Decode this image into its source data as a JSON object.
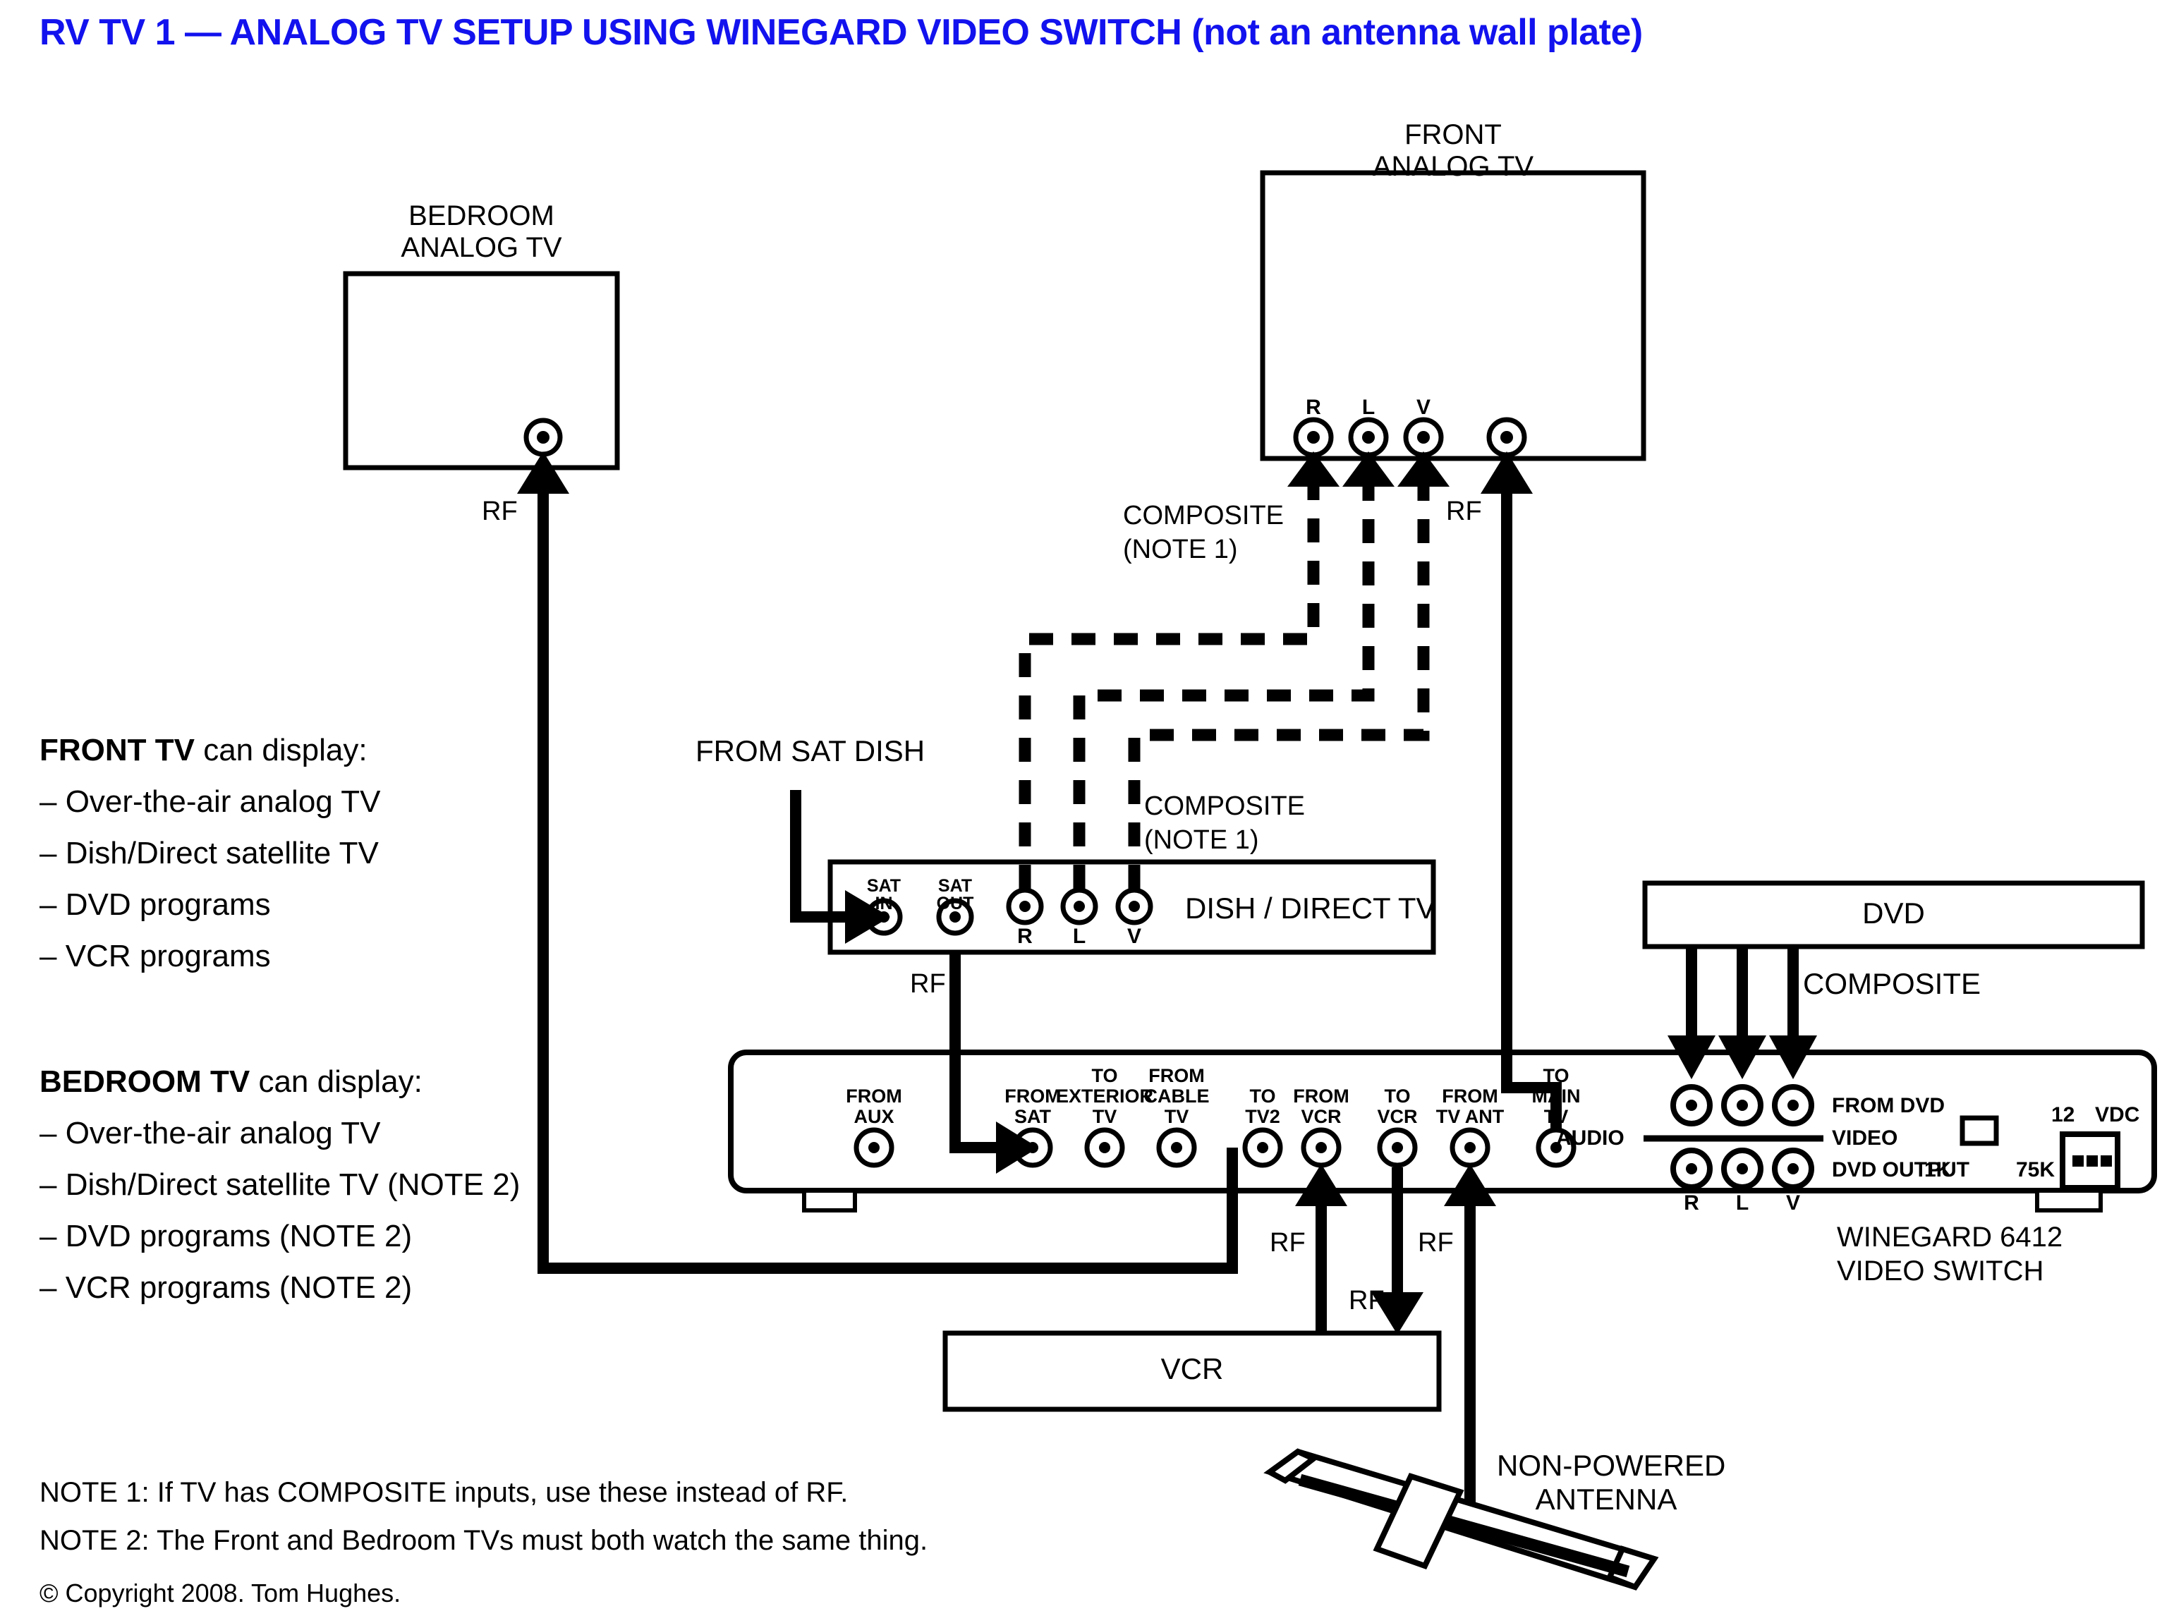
{
  "title": "RV TV 1 — ANALOG TV SETUP USING WINEGARD VIDEO SWITCH (not an antenna wall plate)",
  "colors": {
    "title": "#1212ee",
    "line": "#000000",
    "background": "#ffffff"
  },
  "devices": {
    "bedroom_tv": {
      "label_line1": "BEDROOM",
      "label_line2": "ANALOG TV",
      "rf_label": "RF"
    },
    "front_tv": {
      "label_line1": "FRONT",
      "label_line2": "ANALOG TV",
      "jacks": [
        "R",
        "L",
        "V"
      ],
      "rf_label": "RF"
    },
    "dish": {
      "name": "DISH / DIRECT TV",
      "sat_in": "SAT\nIN",
      "sat_in_l1": "SAT",
      "sat_in_l2": "IN",
      "sat_out_l1": "SAT",
      "sat_out_l2": "OUT",
      "jacks": [
        "R",
        "L",
        "V"
      ],
      "rf_label": "RF"
    },
    "dvd": {
      "name": "DVD",
      "composite_label": "COMPOSITE"
    },
    "vcr": {
      "name": "VCR"
    },
    "antenna": {
      "label_line1": "NON-POWERED",
      "label_line2": "ANTENNA"
    }
  },
  "switch_panel": {
    "brand_line1": "WINEGARD 6412",
    "brand_line2": "VIDEO SWITCH",
    "ports": [
      {
        "l1": "FROM",
        "l2": "AUX"
      },
      {
        "l1": "FROM",
        "l2": "SAT"
      },
      {
        "l1": "TO",
        "l2": "EXTERIOR",
        "l3": "TV"
      },
      {
        "l1": "FROM",
        "l2": "CABLE",
        "l3": "TV"
      },
      {
        "l1": "TO",
        "l2": "TV2"
      },
      {
        "l1": "FROM",
        "l2": "VCR"
      },
      {
        "l1": "TO",
        "l2": "VCR"
      },
      {
        "l1": "FROM",
        "l2": "TV ANT"
      },
      {
        "l1": "TO",
        "l2": "MAIN",
        "l3": "TV"
      }
    ],
    "rca_group": {
      "from_dvd": "FROM DVD",
      "video": "VIDEO",
      "audio": "AUDIO",
      "dvd_output": "DVD OUTPUT",
      "row_labels": [
        "R",
        "L",
        "V"
      ],
      "res_1k": "1K",
      "res_75k": "75K",
      "power_12": "12",
      "power_vdc": "VDC"
    }
  },
  "labels": {
    "from_sat_dish": "FROM SAT DISH",
    "composite_note_top": "COMPOSITE\n(NOTE 1)",
    "composite_note_top_l1": "COMPOSITE",
    "composite_note_top_l2": "(NOTE 1)",
    "composite_note_mid_l1": "COMPOSITE",
    "composite_note_mid_l2": "(NOTE 1)",
    "rf_dish_out": "RF",
    "rf_from_vcr": "RF",
    "rf_to_vcr": "RF",
    "rf_from_ant": "RF",
    "rf_bedroom": "RF",
    "rf_front": "RF"
  },
  "front_tv_text": {
    "heading_bold": "FRONT TV",
    "heading_rest": " can display:",
    "items": [
      "– Over-the-air analog TV",
      "– Dish/Direct satellite TV",
      "– DVD programs",
      "– VCR programs"
    ]
  },
  "bedroom_tv_text": {
    "heading_bold": "BEDROOM TV",
    "heading_rest": " can display:",
    "items": [
      "– Over-the-air analog TV",
      "– Dish/Direct satellite TV (NOTE 2)",
      "– DVD programs (NOTE 2)",
      "– VCR programs (NOTE 2)"
    ]
  },
  "notes": {
    "note1": "NOTE 1: If TV has COMPOSITE inputs, use these instead of RF.",
    "note2": "NOTE 2: The Front and Bedroom TVs must both watch the same thing.",
    "copyright": "© Copyright 2008. Tom Hughes."
  }
}
